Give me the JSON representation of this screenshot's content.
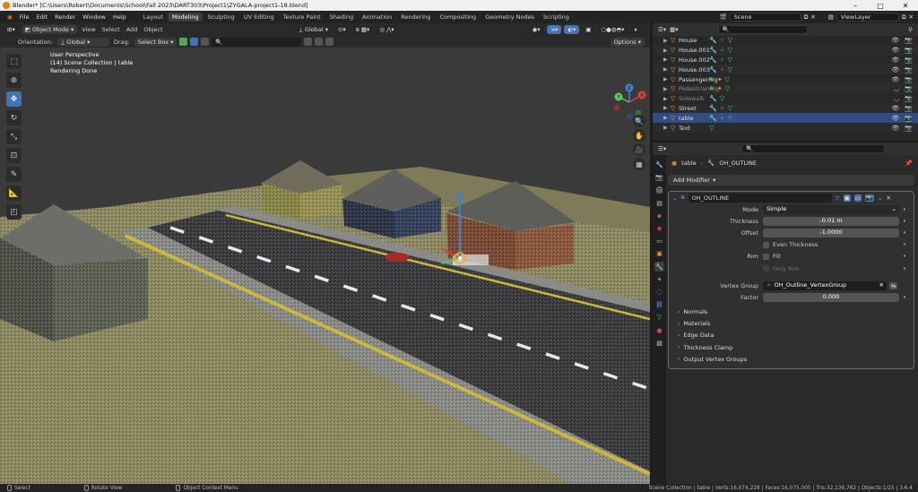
{
  "window": {
    "title": "Blender* [C:\\Users\\Robert\\Documents\\School\\Fall 2023\\DART303\\Project1\\ZYGALA-project1-18.blend]"
  },
  "menu": [
    "File",
    "Edit",
    "Render",
    "Window",
    "Help"
  ],
  "workspaces": [
    {
      "label": "Layout"
    },
    {
      "label": "Modeling",
      "active": true
    },
    {
      "label": "Sculpting"
    },
    {
      "label": "UV Editing"
    },
    {
      "label": "Texture Paint"
    },
    {
      "label": "Shading"
    },
    {
      "label": "Animation"
    },
    {
      "label": "Rendering"
    },
    {
      "label": "Compositing"
    },
    {
      "label": "Geometry Nodes"
    },
    {
      "label": "Scripting"
    }
  ],
  "scene": {
    "name": "Scene",
    "view_layer": "ViewLayer"
  },
  "viewport": {
    "mode": "Object Mode",
    "header_menus": [
      "View",
      "Select",
      "Add",
      "Object"
    ],
    "transform": "Global",
    "orientation_label": "Orientation:",
    "orientation_value": "Global",
    "drag_label": "Drag:",
    "drag_value": "Select Box",
    "options_label": "Options",
    "overlay_lines": [
      "User Perspective",
      "(14) Scene Collection | table",
      "Rendering Done"
    ]
  },
  "gizmo_axes": {
    "x": "X",
    "y": "Y",
    "z": "Z"
  },
  "outliner": {
    "items": [
      {
        "name": "House",
        "modifiers": [
          "wrench",
          "vertex",
          "tri"
        ],
        "dim": false,
        "selected": false
      },
      {
        "name": "House.001",
        "modifiers": [
          "wrench",
          "vertex",
          "tri"
        ],
        "dim": false,
        "selected": false
      },
      {
        "name": "House.002",
        "modifiers": [
          "wrench",
          "vertex",
          "tri"
        ],
        "dim": false,
        "selected": false
      },
      {
        "name": "House.003",
        "modifiers": [
          "wrench",
          "vertex",
          "tri"
        ],
        "dim": false,
        "selected": false
      },
      {
        "name": "PassengerRig",
        "modifiers": [
          "pose",
          "person",
          "tri"
        ],
        "dim": false,
        "selected": false
      },
      {
        "name": "PedestrianRig",
        "modifiers": [
          "pose",
          "person",
          "tri"
        ],
        "dim": true,
        "selected": false
      },
      {
        "name": "Sidewalk",
        "modifiers": [
          "wrench",
          "tri"
        ],
        "dim": true,
        "selected": false
      },
      {
        "name": "Street",
        "modifiers": [
          "wrench",
          "vertex",
          "tri"
        ],
        "dim": false,
        "selected": false
      },
      {
        "name": "table",
        "modifiers": [
          "wrench",
          "vertex",
          "tri"
        ],
        "dim": false,
        "selected": true
      },
      {
        "name": "Text",
        "modifiers": [
          "tri"
        ],
        "dim": false,
        "selected": false
      }
    ]
  },
  "properties": {
    "breadcrumb": {
      "object": "table",
      "modifier": "OH_OUTLINE"
    },
    "add_modifier": "Add Modifier",
    "modifier": {
      "name": "OH_OUTLINE",
      "fields": [
        {
          "label": "Mode",
          "value": "Simple"
        },
        {
          "label": "Thickness",
          "value": "-0.01 m"
        },
        {
          "label": "Offset",
          "value": "-1.0000"
        }
      ],
      "even_thickness": "Even Thickness",
      "rim_label": "Rim",
      "fill": "Fill",
      "only_rim": "Only Rim",
      "vertex_group_label": "Vertex Group",
      "vertex_group_value": "OH_Outline_VertexGroup",
      "factor_label": "Factor",
      "factor_value": "0.000",
      "subpanels": [
        "Normals",
        "Materials",
        "Edge Data",
        "Thickness Clamp",
        "Output Vertex Groups"
      ]
    }
  },
  "statusbar": {
    "select": "Select",
    "rotate": "Rotate View",
    "context": "Object Context Menu",
    "stats": "Scene Collection | table | Verts:16,074,228 | Faces:16,075,005 | Tris:32,136,762 | Objects:1/25 | 3.6.4"
  },
  "colors": {
    "accent": "#4772b3",
    "selected_row": "#334d80",
    "modifier_orange": "#e69b3c",
    "data_green": "#49d17d"
  }
}
